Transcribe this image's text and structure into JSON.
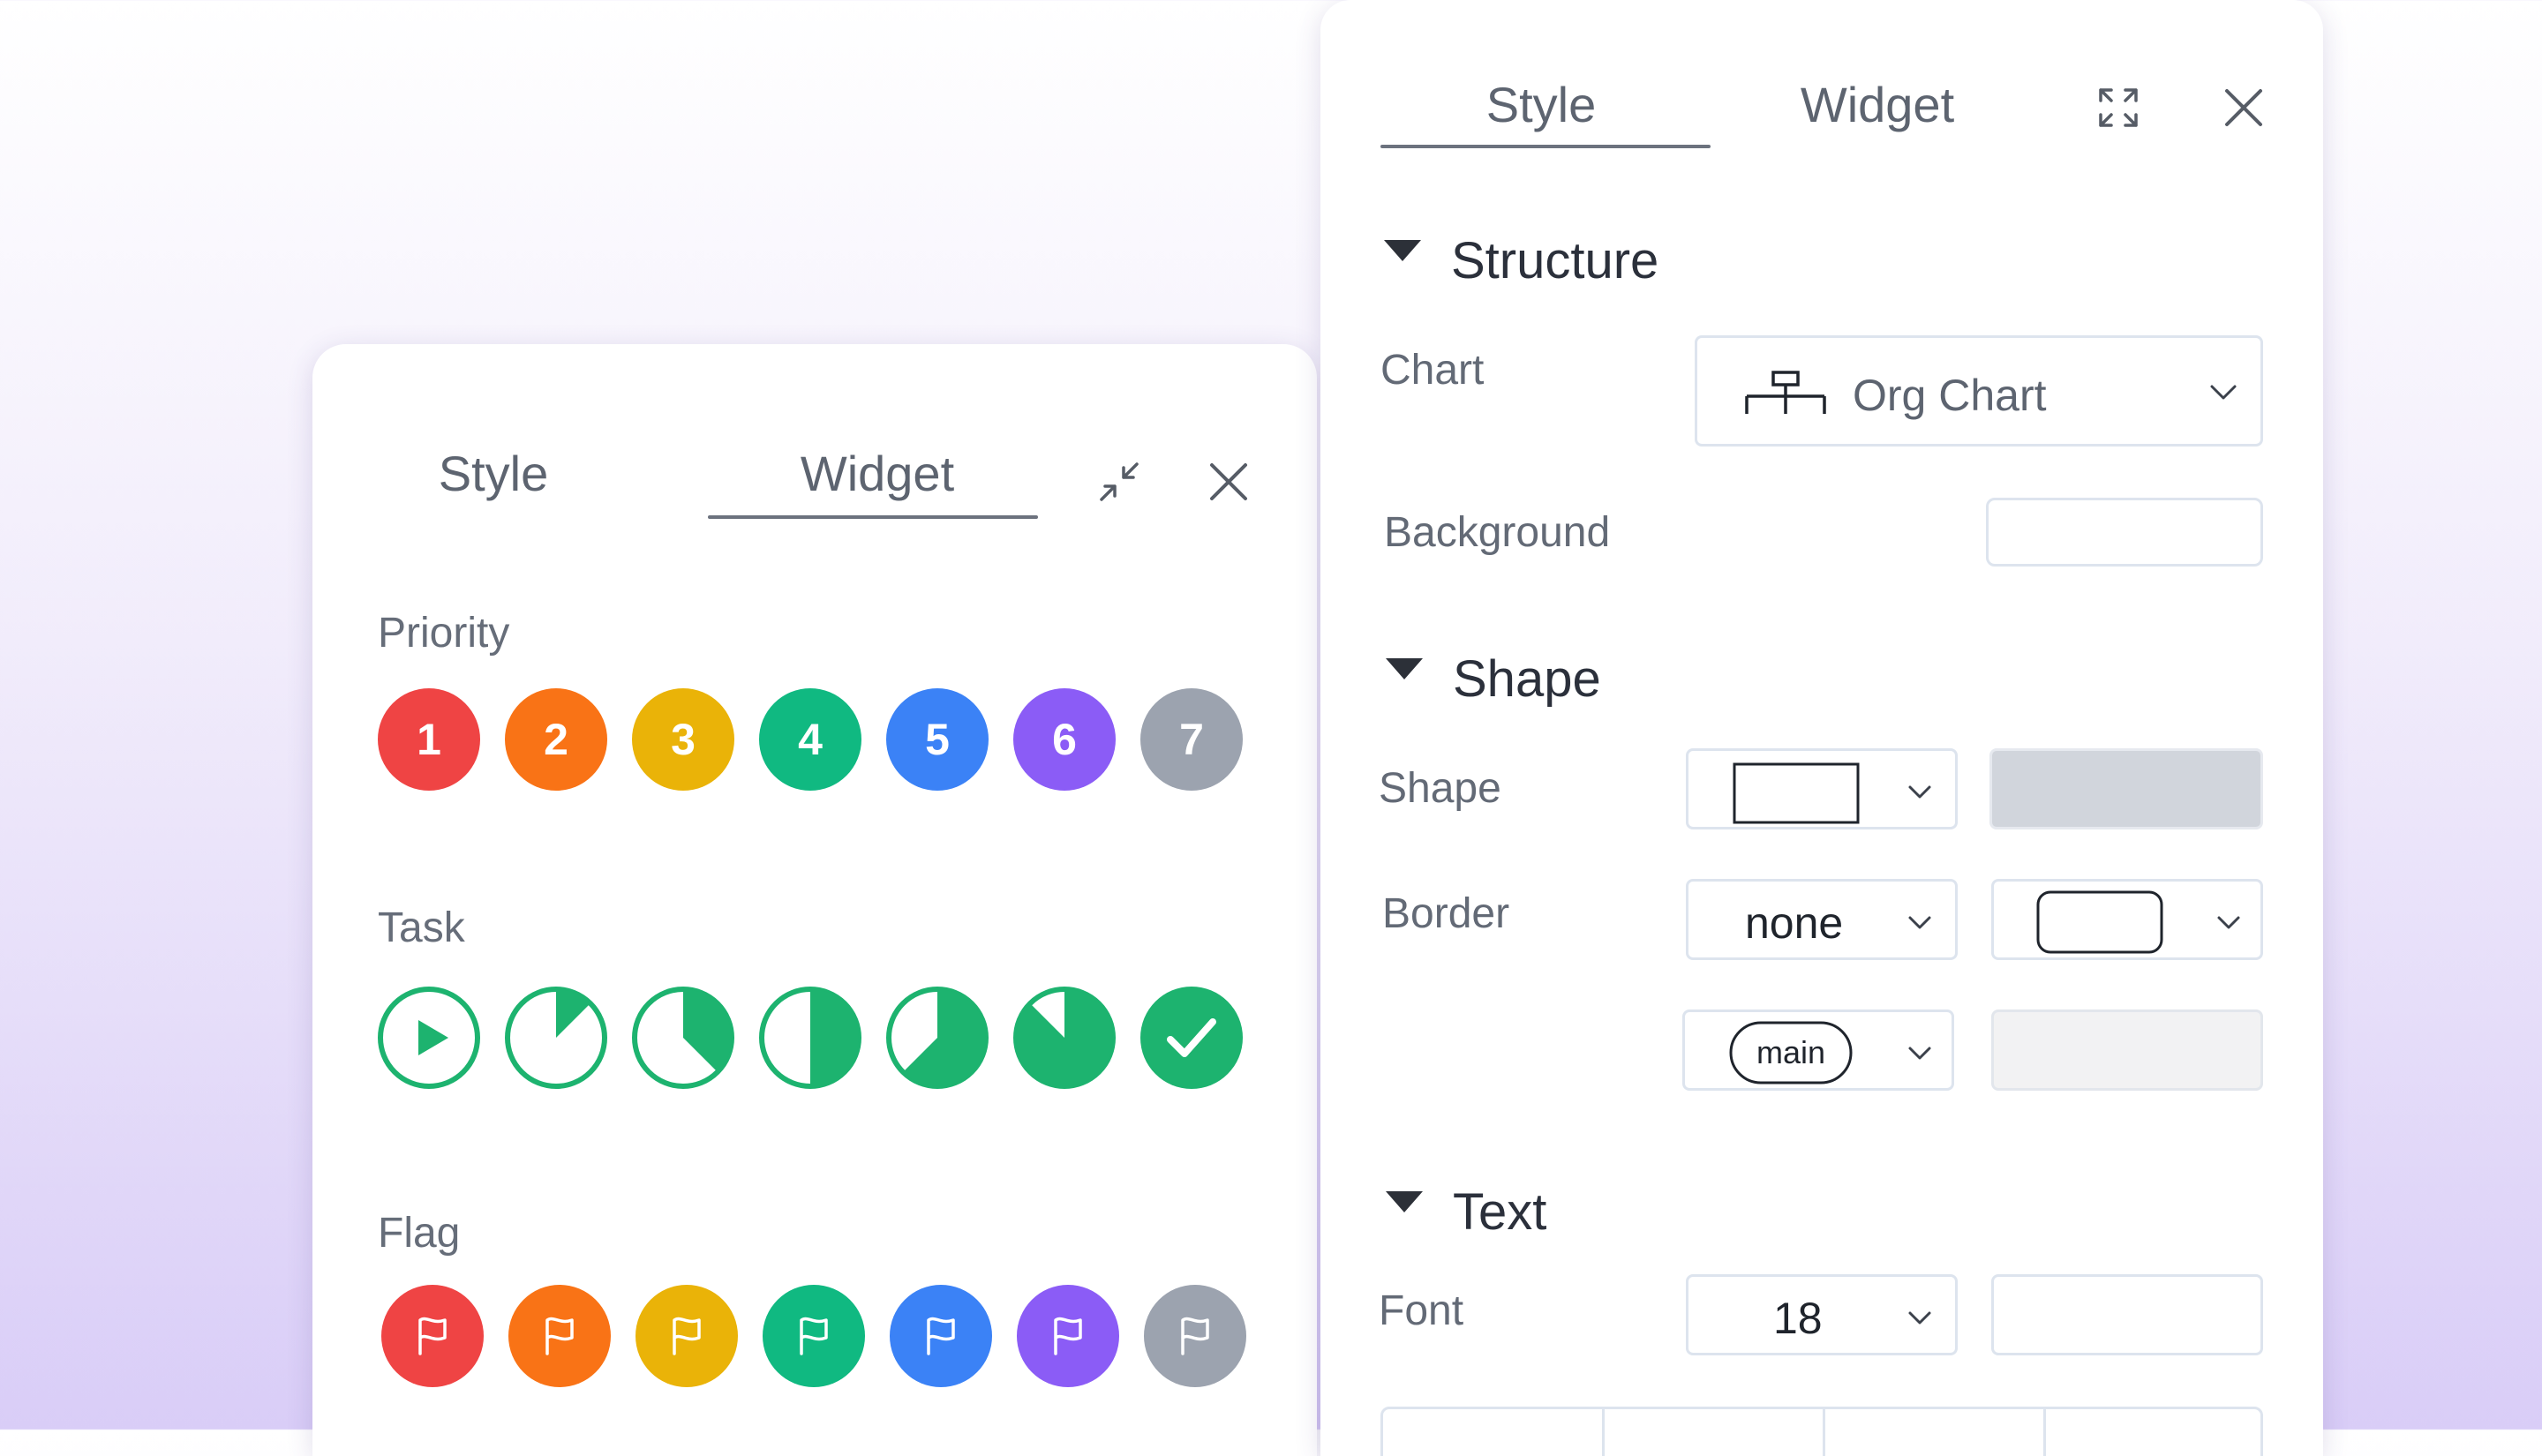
{
  "widget_panel": {
    "tabs": [
      {
        "label": "Style",
        "active": false
      },
      {
        "label": "Widget",
        "active": true
      }
    ],
    "collapse_icon": "collapse-icon",
    "close_icon": "close-icon",
    "priority": {
      "label": "Priority",
      "items": [
        {
          "label": "1",
          "color": "#ef4444"
        },
        {
          "label": "2",
          "color": "#f97316"
        },
        {
          "label": "3",
          "color": "#eab308"
        },
        {
          "label": "4",
          "color": "#10b981"
        },
        {
          "label": "5",
          "color": "#3b82f6"
        },
        {
          "label": "6",
          "color": "#8b5cf6"
        },
        {
          "label": "7",
          "color": "#9ca3af"
        }
      ]
    },
    "task": {
      "label": "Task",
      "color": "#1db36f",
      "items": [
        {
          "icon": "play-icon",
          "progress": 0
        },
        {
          "icon": "progress-icon",
          "progress": 0.125
        },
        {
          "icon": "progress-icon",
          "progress": 0.375
        },
        {
          "icon": "progress-icon",
          "progress": 0.5
        },
        {
          "icon": "progress-icon",
          "progress": 0.625
        },
        {
          "icon": "progress-icon",
          "progress": 0.875
        },
        {
          "icon": "check-icon",
          "progress": 1
        }
      ]
    },
    "flag": {
      "label": "Flag",
      "icon": "flag-icon",
      "colors": [
        "#ef4444",
        "#f97316",
        "#eab308",
        "#10b981",
        "#3b82f6",
        "#8b5cf6",
        "#9ca3af"
      ]
    }
  },
  "style_panel": {
    "tabs": [
      {
        "label": "Style",
        "active": true
      },
      {
        "label": "Widget",
        "active": false
      }
    ],
    "expand_icon": "expand-icon",
    "close_icon": "close-icon",
    "structure": {
      "heading": "Structure",
      "chart_label": "Chart",
      "chart_value": "Org Chart",
      "chart_icon": "org-chart-icon",
      "background_label": "Background"
    },
    "shape": {
      "heading": "Shape",
      "shape_label": "Shape",
      "shape_icon": "rectangle-icon",
      "border_label": "Border",
      "border_value": "none",
      "border_shape_icon": "rounded-rectangle-icon",
      "line_value": "main"
    },
    "text": {
      "heading": "Text",
      "font_label": "Font",
      "font_size": "18"
    }
  }
}
